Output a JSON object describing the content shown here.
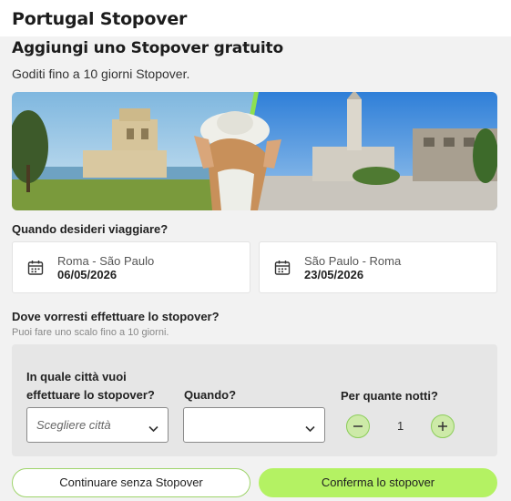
{
  "header": {
    "title": "Portugal Stopover"
  },
  "offer": {
    "title": "Aggiungi uno Stopover gratuito",
    "subtitle": "Goditi fino a 10 giorni Stopover."
  },
  "travel": {
    "question": "Quando desideri viaggiare?",
    "outbound": {
      "route": "Roma - São Paulo",
      "date": "06/05/2026",
      "icon": "calendar-icon"
    },
    "return": {
      "route": "São Paulo - Roma",
      "date": "23/05/2026",
      "icon": "calendar-icon"
    }
  },
  "stopover": {
    "question": "Dove vorresti effettuare lo stopover?",
    "hint": "Puoi fare uno scalo fino a 10 giorni.",
    "city_label_line1": "In quale città vuoi",
    "city_label_line2": "effettuare lo stopover?",
    "city_placeholder": "Scegliere città",
    "when_label": "Quando?",
    "when_value": "",
    "nights_label": "Per quante notti?",
    "nights_value": "1"
  },
  "actions": {
    "skip_label": "Continuare senza Stopover",
    "confirm_label": "Conferma lo stopover"
  },
  "colors": {
    "accent": "#b4f263",
    "accent_border": "#9ed46a",
    "stepper": "#cdeaa8"
  }
}
